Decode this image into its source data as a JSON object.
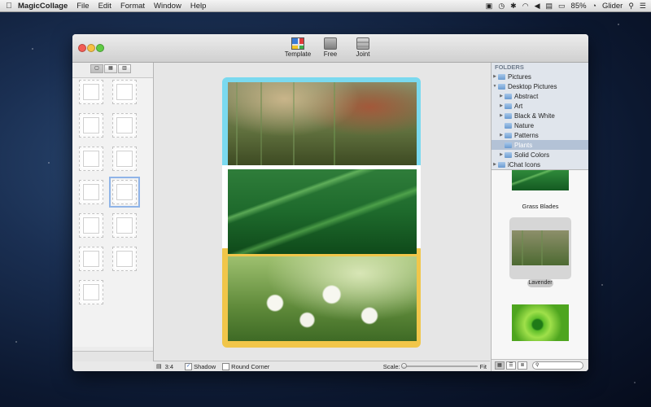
{
  "menubar": {
    "app_name": "MagicCollage",
    "menus": [
      "File",
      "Edit",
      "Format",
      "Window",
      "Help"
    ],
    "battery": "85%",
    "user": "Glider"
  },
  "toolbar": {
    "template_label": "Template",
    "free_label": "Free",
    "joint_label": "Joint"
  },
  "canvas_bar": {
    "ratio": "3:4",
    "shadow_label": "Shadow",
    "shadow_checked": true,
    "round_corner_label": "Round Corner",
    "round_corner_checked": false,
    "scale_label": "Scale:",
    "fit_label": "Fit"
  },
  "folders": {
    "header": "FOLDERS",
    "items": [
      {
        "label": "Pictures",
        "level": 0,
        "expanded": false,
        "selected": false
      },
      {
        "label": "Desktop Pictures",
        "level": 0,
        "expanded": true,
        "selected": false
      },
      {
        "label": "Abstract",
        "level": 1,
        "expanded": false,
        "selected": false
      },
      {
        "label": "Art",
        "level": 1,
        "expanded": false,
        "selected": false
      },
      {
        "label": "Black & White",
        "level": 1,
        "expanded": false,
        "selected": false
      },
      {
        "label": "Nature",
        "level": 1,
        "expanded": false,
        "selected": false
      },
      {
        "label": "Patterns",
        "level": 1,
        "expanded": false,
        "selected": false
      },
      {
        "label": "Plants",
        "level": 1,
        "expanded": false,
        "selected": true
      },
      {
        "label": "Solid Colors",
        "level": 1,
        "expanded": false,
        "selected": false
      },
      {
        "label": "iChat Icons",
        "level": 0,
        "expanded": false,
        "selected": false
      }
    ]
  },
  "thumbnails": {
    "grass_blades": "Grass Blades",
    "lavender": "Lavender"
  }
}
